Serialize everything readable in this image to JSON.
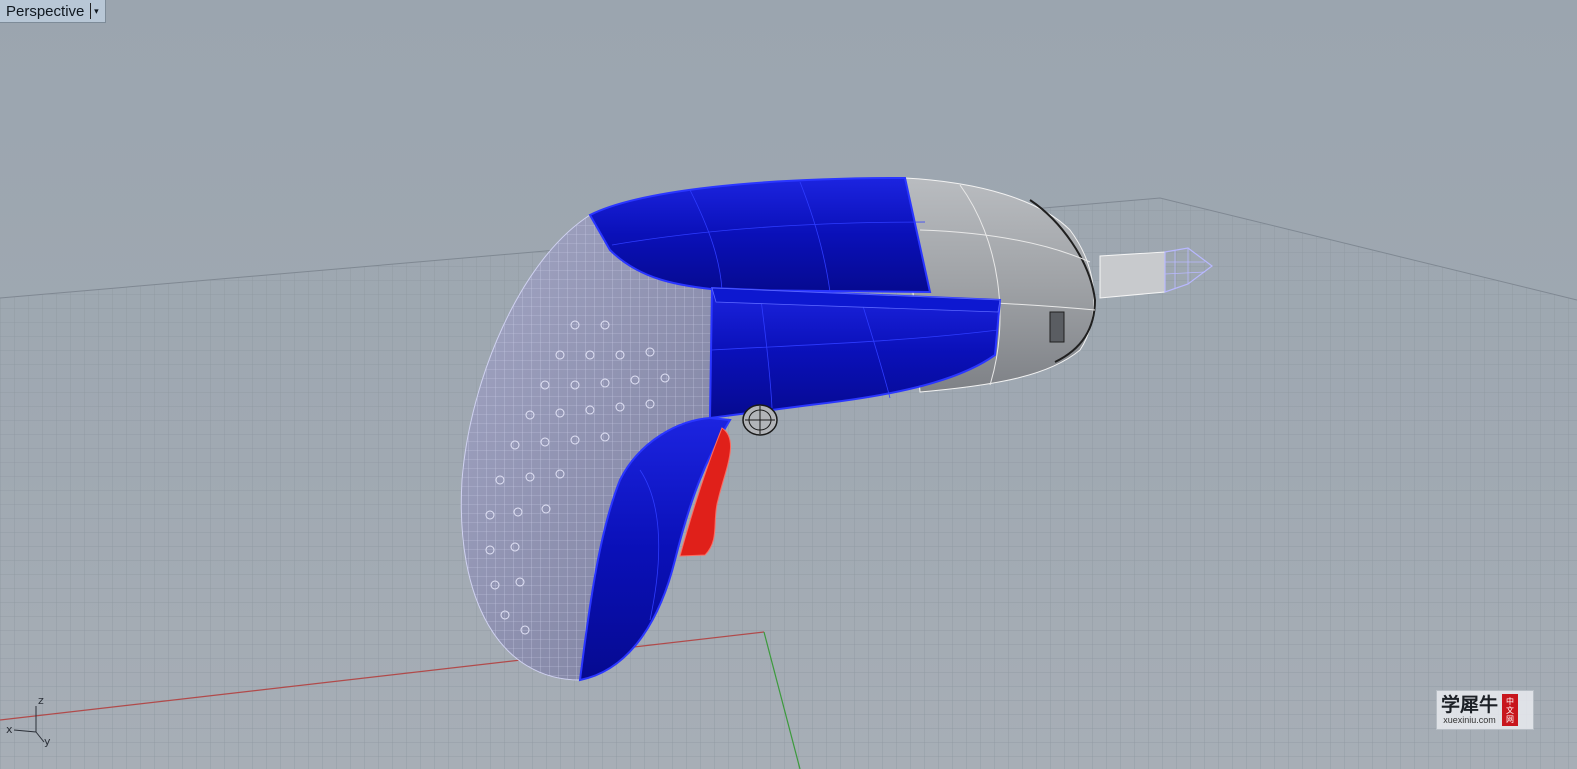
{
  "viewport": {
    "name": "Perspective",
    "menu_caret": "▾"
  },
  "axes": {
    "z": "z",
    "x": "x",
    "y": "y"
  },
  "colors": {
    "background": "#9ba5af",
    "grid": "#8f98a1",
    "x_axis": "#b14a4a",
    "y_axis": "#3c9a3c",
    "selected_surface": "#0a12c8",
    "wireframe": "#c9ccf0",
    "nose_surface": "#9a9da2",
    "trigger": "#e0201a",
    "bit_wire": "#b8b8ff"
  },
  "watermark": {
    "cn": "学犀牛",
    "url": "xuexiniu.com",
    "badge": [
      "中",
      "文",
      "网"
    ]
  }
}
